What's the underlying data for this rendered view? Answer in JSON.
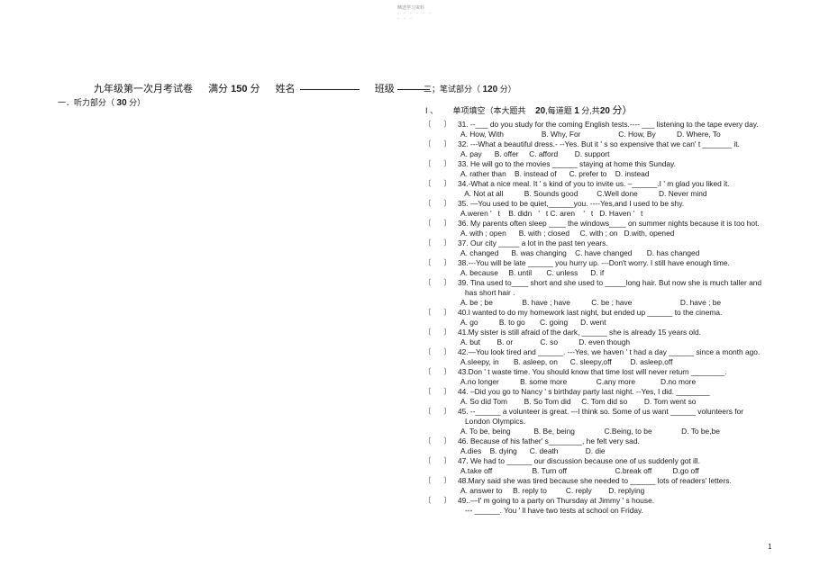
{
  "watermark": {
    "text": "精选学习资料",
    "dashes1": "- - - - - -",
    "dashes2": "- - -"
  },
  "header": {
    "title": "九年级第一次月考试卷",
    "score_label": "满分",
    "score_value": "150",
    "score_unit": "分",
    "name_label": "姓名",
    "class_label": "班级"
  },
  "section1": {
    "label": "一．听力部分（",
    "points": "30",
    "suffix": "分）"
  },
  "section2": {
    "label": "二；笔试部分（",
    "points": "120",
    "suffix": "分）"
  },
  "part1": {
    "numeral": "I 、",
    "label": "单项填空（本大题共",
    "count": "20",
    "each_label": ",每道题",
    "each": "1",
    "total_label": "分,共",
    "total": "20",
    "suffix": "分）"
  },
  "bracket": {
    "open": "〔",
    "close": "〕"
  },
  "questions": [
    {
      "stem": "31. --___ do you study for the coming English tests.---- ___ listening to the tape every day.",
      "options": "A. How, With                  B. Why, For                  C. How, By          D. Where, To"
    },
    {
      "stem": "32.  ---What a beautiful dress.- --Yes. But it ' s so expensive that we can' t _______ it.",
      "options": "A. pay      B. offer     C. afford        D. support"
    },
    {
      "stem": "33. He will go to the movies ______ staying at home this Sunday.",
      "options": "A. rather than    B. instead of      C. prefer to    D. instead"
    },
    {
      "stem": "34.-What a nice meal. It ' s kind of you to invite us. –______.I ' m glad you liked it.",
      "options": "  A. Not at all          B. Sounds good         C.Well done          D. Never mind"
    },
    {
      "stem": "35. —You used to be quiet,______you.        ----Yes,and I used to be shy.",
      "options": "A.weren '   t    B. didn   '   t C. aren    '   t   D. Haven '   t"
    },
    {
      "stem": "36. My parents often sleep ____ the windows____ on summer nights because it is too hot.",
      "options": "A. with ; open      B. with ; closed     C. with ; on   D.with, opened"
    },
    {
      "stem": "37. Our city _____ a lot in the past ten years.",
      "options": "A. changed      B. was changing    C. have changed       D. has changed"
    },
    {
      "stem": "38.---You will be late ______ you hurry up. ---Don't worry. I still have enough time.",
      "options": "A. because     B. until       C. unless      D. if"
    },
    {
      "stem": "39. Tina used to____ short and she used to _____long hair. But now she is much taller and",
      "cont": "has short hair .",
      "options": "A. be ; be              B. have ; have          C. be ; have                       D. have ; be"
    },
    {
      "stem": "40.I wanted to do my homework last night, but ended up ______  to the cinema.",
      "options": "A. go          B. to go       C. going      D. went"
    },
    {
      "stem": "41.My sister is still afraid of the dark,  ______ she is already 15 years old.",
      "options": "A. but        B. or             C. so          D. even though"
    },
    {
      "stem": "42.—You look tired and ______. ---Yes, we haven ' t had a day ______ since a month ago.",
      "options": "A.sleepy, in       B. asleep, on      C. sleepy,off         D. asleep,off"
    },
    {
      "stem": "43.Don ' t waste time. You should know that time lost will never return ________.",
      "options": "A.no longer          B. some more              C.any more            D.no more"
    },
    {
      "stem": "44. –Did you go to Nancy ' s birthday party last night.       --Yes, I did. ________",
      "options": "A. So did Tom        B. So Tom did     C. Tom did so        D. Tom went so"
    },
    {
      "stem": "45. --______ a volunteer is great. –-I think so. Some of us want              ______ volunteers for",
      "cont": "London Olympics.",
      "options": "A. To be, being           B. Be, being              C.Being, to be              D. To be,be"
    },
    {
      "stem": "46. Because of his father' s________, he felt very sad.",
      "options": "A.dies    B. dying      C. death             D. die"
    },
    {
      "stem": "47. We had to ______ our discussion because one of us suddenly got ill.",
      "options": "A.take off                   B. Turn off                       C.break off          D.go off"
    },
    {
      "stem": "48.Mary said she was tired because she needed to ______ lots of readers'  letters.",
      "options": "A. answer to     B. reply to         C. reply        D. replying"
    },
    {
      "stem": "49..—I' m going to a party on Thursday at Jimmy ' s house.",
      "cont2": "--- ______. You ' ll have two tests at school on Friday."
    }
  ],
  "page_number": "1"
}
